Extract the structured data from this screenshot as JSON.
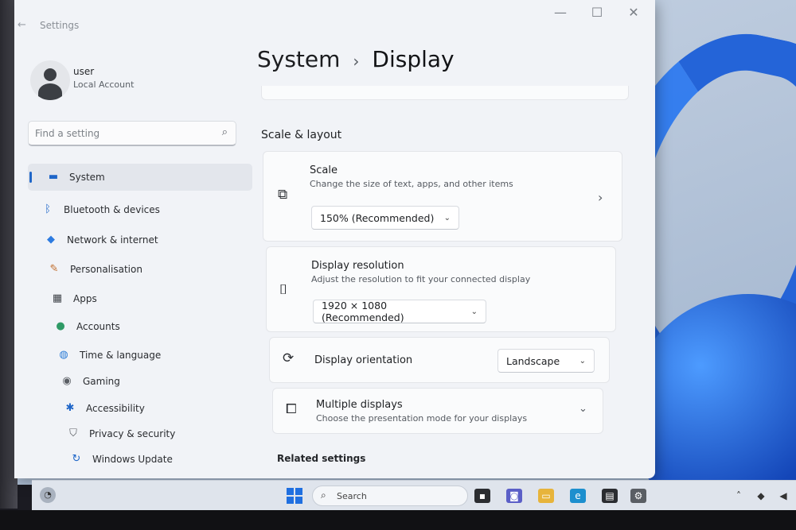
{
  "window": {
    "app_title": "Settings",
    "controls": {
      "minimize": "—",
      "maximize": "☐",
      "close": "✕"
    }
  },
  "profile": {
    "name": "user",
    "account_type": "Local Account"
  },
  "search": {
    "placeholder": "Find a setting"
  },
  "sidebar": {
    "items": [
      {
        "label": "System",
        "icon": "monitor-icon",
        "glyph": "▬",
        "color": "#1f66c8",
        "active": true
      },
      {
        "label": "Bluetooth & devices",
        "icon": "bluetooth-icon",
        "glyph": "ᛒ",
        "color": "#1f66c8"
      },
      {
        "label": "Network & internet",
        "icon": "wifi-icon",
        "glyph": "◆",
        "color": "#2d7be0"
      },
      {
        "label": "Personalisation",
        "icon": "brush-icon",
        "glyph": "✎",
        "color": "#c06d2c"
      },
      {
        "label": "Apps",
        "icon": "apps-icon",
        "glyph": "▦",
        "color": "#40444a"
      },
      {
        "label": "Accounts",
        "icon": "person-icon",
        "glyph": "●",
        "color": "#2f9a66"
      },
      {
        "label": "Time & language",
        "icon": "globe-icon",
        "glyph": "◍",
        "color": "#2b7bd6"
      },
      {
        "label": "Gaming",
        "icon": "gamepad-icon",
        "glyph": "◉",
        "color": "#5a5e64"
      },
      {
        "label": "Accessibility",
        "icon": "accessibility-icon",
        "glyph": "✱",
        "color": "#1f66c8"
      },
      {
        "label": "Privacy & security",
        "icon": "shield-icon",
        "glyph": "⛉",
        "color": "#5a5e64"
      },
      {
        "label": "Windows Update",
        "icon": "update-icon",
        "glyph": "↻",
        "color": "#1f66c8"
      }
    ]
  },
  "breadcrumb": {
    "parent": "System",
    "separator": "›",
    "current": "Display"
  },
  "section": {
    "title": "Scale & layout"
  },
  "scale": {
    "title": "Scale",
    "subtitle": "Change the size of text, apps, and other items",
    "value": "150% (Recommended)"
  },
  "resolution": {
    "title": "Display resolution",
    "subtitle": "Adjust the resolution to fit your connected display",
    "value": "1920 × 1080 (Recommended)"
  },
  "orientation": {
    "title": "Display orientation",
    "value": "Landscape"
  },
  "multiple": {
    "title": "Multiple displays",
    "subtitle": "Choose the presentation mode for your displays"
  },
  "related": {
    "title": "Related settings"
  },
  "taskbar": {
    "search_label": "Search"
  },
  "colors": {
    "accent": "#1f66c8",
    "wallpaper_blue": "#1d5fd8"
  }
}
